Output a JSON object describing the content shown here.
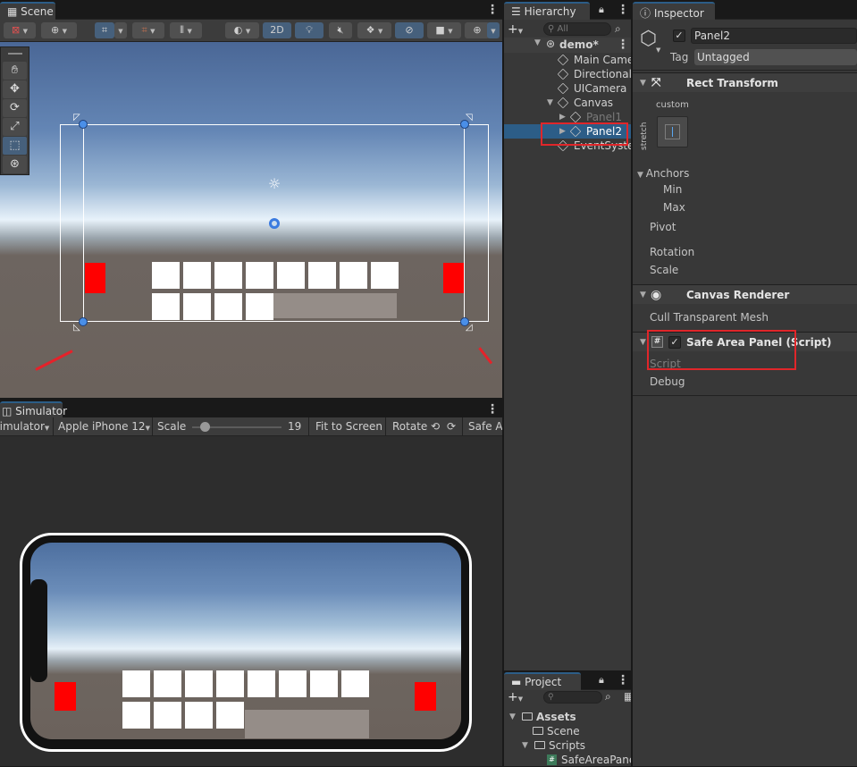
{
  "scene": {
    "tab": "Scene",
    "toolbar": {
      "mode_2d": "2D"
    },
    "tools": [
      "hand-tool-icon",
      "move-tool-icon",
      "rotate-tool-icon",
      "scale-tool-icon",
      "rect-tool-icon",
      "transform-tool-icon"
    ],
    "active_tool": "rect-tool-icon"
  },
  "simulator": {
    "tab": "Simulator",
    "mode": "Simulator",
    "device": "Apple iPhone 12",
    "scale_label": "Scale",
    "scale_value": "19",
    "fit": "Fit to Screen",
    "rotate": "Rotate",
    "safe_area": "Safe A"
  },
  "hierarchy": {
    "tab": "Hierarchy",
    "search_placeholder": "All",
    "scene_name": "demo*",
    "items": [
      {
        "label": "Main Came",
        "depth": 1
      },
      {
        "label": "Directional",
        "depth": 1
      },
      {
        "label": "UICamera",
        "depth": 1
      },
      {
        "label": "Canvas",
        "depth": 1,
        "expanded": true
      },
      {
        "label": "Panel1",
        "depth": 2,
        "disabled": true
      },
      {
        "label": "Panel2",
        "depth": 2,
        "selected": true
      },
      {
        "label": "EventSyste",
        "depth": 1
      }
    ]
  },
  "project": {
    "tab": "Project",
    "tree": [
      {
        "label": "Assets",
        "depth": 0
      },
      {
        "label": "Scene",
        "depth": 1
      },
      {
        "label": "Scripts",
        "depth": 1
      },
      {
        "label": "SafeAreaPane",
        "depth": 2
      }
    ]
  },
  "inspector": {
    "tab": "Inspector",
    "object_name": "Panel2",
    "tag_label": "Tag",
    "tag_value": "Untagged",
    "rect_transform": {
      "title": "Rect Transform",
      "preset_label": "custom",
      "stretch_label": "stretch",
      "anchors": "Anchors",
      "min": "Min",
      "max": "Max",
      "pivot": "Pivot",
      "rotation": "Rotation",
      "scale": "Scale"
    },
    "canvas_renderer": {
      "title": "Canvas Renderer",
      "cull": "Cull Transparent Mesh"
    },
    "safe_area": {
      "title": "Safe Area Panel (Script)",
      "script": "Script",
      "debug": "Debug"
    }
  },
  "colors": {
    "accent": "#2c5d87",
    "selection": "#2c5d87",
    "highlight_box": "#e0262a"
  }
}
